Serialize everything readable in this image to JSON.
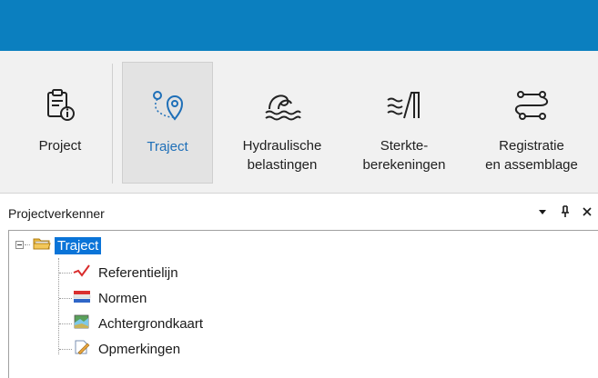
{
  "ribbon": {
    "buttons": [
      {
        "label": "Project",
        "icon": "clipboard-info-icon"
      },
      {
        "label": "Traject",
        "icon": "route-pin-icon",
        "active": true
      },
      {
        "label": "Hydraulische\nbelastingen",
        "icon": "waves-icon"
      },
      {
        "label": "Sterkte-\nberekeningen",
        "icon": "dike-wall-icon"
      },
      {
        "label": "Registratie\nen assemblage",
        "icon": "flow-links-icon"
      }
    ]
  },
  "panel": {
    "title": "Projectverkenner",
    "controls": {
      "dropdown": "▾",
      "pin": "ᛘ",
      "close": "✕"
    }
  },
  "tree": {
    "root": {
      "label": "Traject",
      "icon": "folder-icon",
      "selected": true
    },
    "children": [
      {
        "label": "Referentielijn",
        "icon": "reference-line-icon"
      },
      {
        "label": "Normen",
        "icon": "norms-icon"
      },
      {
        "label": "Achtergrondkaart",
        "icon": "map-icon"
      },
      {
        "label": "Opmerkingen",
        "icon": "note-icon"
      }
    ]
  },
  "colors": {
    "accent": "#0b7fbf",
    "selection": "#0a74d8",
    "active_label": "#1e6fb8"
  }
}
